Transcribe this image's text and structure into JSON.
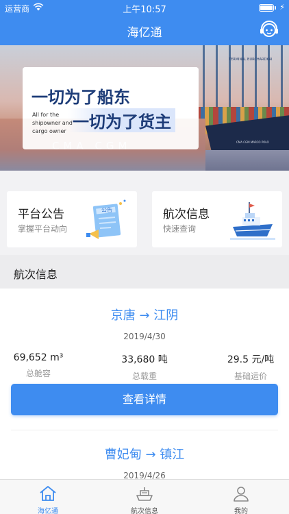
{
  "status_bar": {
    "carrier": "运营商",
    "time": "上午10:57",
    "wifi_icon": "wifi-icon",
    "battery_level": 1.0
  },
  "nav": {
    "title": "海亿通",
    "support_icon": "customer-service-icon"
  },
  "banner": {
    "slogan_main": "一切为了船东",
    "slogan_sub": "一切为了货主",
    "english": "All for the shipowner and cargo owner",
    "hull_text": "CMA CGM",
    "ship_name": "CMA CGM MARCO POLO",
    "terminal_text": "TERMINAL BURCHARDKAI"
  },
  "quick_links": [
    {
      "title": "平台公告",
      "subtitle": "掌握平台动向",
      "icon": "announcement-icon",
      "icon_text": "公告"
    },
    {
      "title": "航次信息",
      "subtitle": "快速查询",
      "icon": "ship-icon"
    }
  ],
  "section": {
    "title": "航次信息"
  },
  "voyages": [
    {
      "route": "京唐 → 江阴",
      "date": "2019/4/30",
      "capacity": "69,652 m³",
      "capacity_label": "总舱容",
      "load": "33,680 吨",
      "load_label": "总载重",
      "rate": "29.5 元/吨",
      "rate_label": "基础运价",
      "button": "查看详情"
    },
    {
      "route": "曹妃甸 → 镇江",
      "date": "2019/4/26"
    }
  ],
  "tabs": [
    {
      "label": "海亿通",
      "icon": "home-icon",
      "active": true
    },
    {
      "label": "航次信息",
      "icon": "ship-icon",
      "active": false
    },
    {
      "label": "我的",
      "icon": "user-icon",
      "active": false
    }
  ],
  "colors": {
    "primary": "#3e8cf0",
    "text": "#222222",
    "muted": "#999999",
    "inactive_tab": "#888888"
  }
}
